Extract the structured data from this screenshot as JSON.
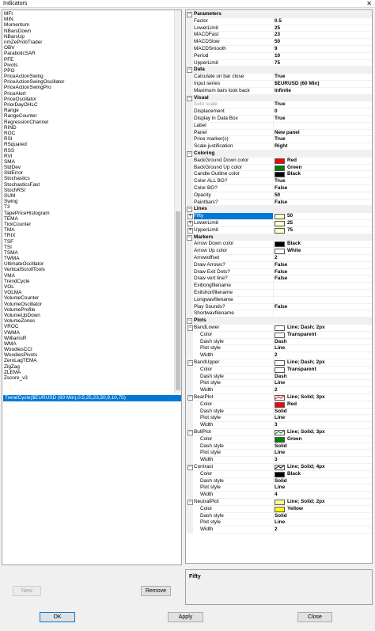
{
  "window": {
    "title": "Indicators",
    "close_glyph": "✕"
  },
  "indicator_list": {
    "items": [
      "MFI",
      "MIN",
      "Momentum",
      "NBarsDown",
      "NBarsUp",
      "nmZeProbTrader",
      "OBV",
      "ParabolicSAR",
      "PFE",
      "Pivots",
      "PPO",
      "PriceActionSwing",
      "PriceActionSwingOscillator",
      "PriceActionSwingPro",
      "PriceAlert",
      "PriceOscillator",
      "PriorDayOHLC",
      "Range",
      "RangeCounter",
      "RegressionChannel",
      "RIND",
      "ROC",
      "RSI",
      "RSquared",
      "RSS",
      "RVI",
      "SMA",
      "StdDev",
      "StdError",
      "Stochastics",
      "StochasticsFast",
      "StochRSI",
      "SUM",
      "Swing",
      "T3",
      "TapePriceHistogram",
      "TEMA",
      "TickCounter",
      "TMA",
      "TRIX",
      "TSF",
      "TSI",
      "TSMA",
      "TWMA",
      "UltimateOscillator",
      "VerticalScrollTools",
      "VMA",
      "TrendCycle",
      "VOL",
      "VOLMA",
      "VolumeCounter",
      "VolumeOscillator",
      "VolumeProfile",
      "VolumeUpDown",
      "VolumeZones",
      "VROC",
      "VWMA",
      "WilliamsR",
      "WMA",
      "WoodiesCCI",
      "WoodiesPivots",
      "ZeroLagTEMA",
      "ZigZag",
      "ZLEMA",
      "Zscore_v3"
    ],
    "selected": "TrendCycle($EURUSD (60 Min),0.5,25,23,50,9,10,75)"
  },
  "buttons": {
    "new": "New",
    "remove": "Remove",
    "ok": "OK",
    "apply": "Apply",
    "close": "Close"
  },
  "description": "Fifty",
  "properties": [
    {
      "type": "section",
      "label": "Parameters"
    },
    {
      "label": "Factor",
      "value": "0.5"
    },
    {
      "label": "LowerLimit",
      "value": "25"
    },
    {
      "label": "MACDFast",
      "value": "23"
    },
    {
      "label": "MACDSlow",
      "value": "50"
    },
    {
      "label": "MACDSmooth",
      "value": "9"
    },
    {
      "label": "Period",
      "value": "10"
    },
    {
      "label": "UpperLimit",
      "value": "75"
    },
    {
      "type": "section",
      "label": "Data"
    },
    {
      "label": "Calculate on bar close",
      "value": "True"
    },
    {
      "label": "Input series",
      "value": "$EURUSD (60 Min)"
    },
    {
      "label": "Maximum bars look back",
      "value": "Infinite"
    },
    {
      "type": "section",
      "label": "Visual"
    },
    {
      "label": "Auto scale",
      "value": "True",
      "dim": true
    },
    {
      "label": "Displacement",
      "value": "0"
    },
    {
      "label": "Display in Data Box",
      "value": "True"
    },
    {
      "label": "Label",
      "value": ""
    },
    {
      "label": "Panel",
      "value": "New panel"
    },
    {
      "label": "Price marker(s)",
      "value": "True"
    },
    {
      "label": "Scale justification",
      "value": "Right"
    },
    {
      "type": "section",
      "label": "Coloring"
    },
    {
      "label": "BackGround Down color",
      "value": "Red",
      "color": "#ff0000"
    },
    {
      "label": "BackGround Up color",
      "value": "Green",
      "color": "#008000"
    },
    {
      "label": "Candle Outline color",
      "value": "Black",
      "color": "#000000"
    },
    {
      "label": "Color ALL BG?",
      "value": "True"
    },
    {
      "label": "Color BG?",
      "value": "False"
    },
    {
      "label": "Opacity",
      "value": "50"
    },
    {
      "label": "Paintbars?",
      "value": "False"
    },
    {
      "type": "section",
      "label": "Lines"
    },
    {
      "label": "Fifty",
      "value": "50",
      "color": "#ffffc8",
      "toggle": "+",
      "selected": true
    },
    {
      "label": "LowerLimit",
      "value": "25",
      "color": "#ffffc8",
      "toggle": "+"
    },
    {
      "label": "UpperLimit",
      "value": "75",
      "color": "#ffffc8",
      "toggle": "+"
    },
    {
      "type": "section",
      "label": "Markers"
    },
    {
      "label": "Arrow Down color",
      "value": "Black",
      "color": "#000000"
    },
    {
      "label": "Arrow Up color",
      "value": "White",
      "color": "#ffffff"
    },
    {
      "label": "Arrowoffset",
      "value": "2"
    },
    {
      "label": "Draw Arrows?",
      "value": "False"
    },
    {
      "label": "Draw Exit Dots?",
      "value": "False"
    },
    {
      "label": "Draw vert line?",
      "value": "False"
    },
    {
      "label": "Exitlongfilename",
      "value": ""
    },
    {
      "label": "Exitshortfilename",
      "value": ""
    },
    {
      "label": "Longwavfilename",
      "value": ""
    },
    {
      "label": "Play Sounds?",
      "value": "False"
    },
    {
      "label": "Shortwavfilename",
      "value": ""
    },
    {
      "type": "section",
      "label": "Plots"
    },
    {
      "label": "BandLower",
      "value": "Line; Dash; 2px",
      "color": "#ffffff",
      "toggle": "−"
    },
    {
      "label": "Color",
      "value": "Transparent",
      "color": "#ffffff",
      "indent": true
    },
    {
      "label": "Dash style",
      "value": "Dash",
      "indent": true
    },
    {
      "label": "Plot style",
      "value": "Line",
      "indent": true
    },
    {
      "label": "Width",
      "value": "2",
      "indent": true
    },
    {
      "label": "BandUpper",
      "value": "Line; Dash; 2px",
      "color": "#ffffff",
      "toggle": "−"
    },
    {
      "label": "Color",
      "value": "Transparent",
      "color": "#ffffff",
      "indent": true
    },
    {
      "label": "Dash style",
      "value": "Dash",
      "indent": true
    },
    {
      "label": "Plot style",
      "value": "Line",
      "indent": true
    },
    {
      "label": "Width",
      "value": "2",
      "indent": true
    },
    {
      "label": "BearPlot",
      "value": "Line; Solid; 3px",
      "color": "#ffffff",
      "toggle": "−",
      "linecolor": "#ff0000"
    },
    {
      "label": "Color",
      "value": "Red",
      "color": "#ff0000",
      "indent": true
    },
    {
      "label": "Dash style",
      "value": "Solid",
      "indent": true
    },
    {
      "label": "Plot style",
      "value": "Line",
      "indent": true
    },
    {
      "label": "Width",
      "value": "3",
      "indent": true
    },
    {
      "label": "BullPlot",
      "value": "Line; Solid; 3px",
      "color": "#ffffff",
      "toggle": "−",
      "linecolor": "#008000"
    },
    {
      "label": "Color",
      "value": "Green",
      "color": "#008000",
      "indent": true
    },
    {
      "label": "Dash style",
      "value": "Solid",
      "indent": true
    },
    {
      "label": "Plot style",
      "value": "Line",
      "indent": true
    },
    {
      "label": "Width",
      "value": "3",
      "indent": true
    },
    {
      "label": "Contrast",
      "value": "Line; Solid; 4px",
      "color": "#ffffff",
      "toggle": "−",
      "linecolor": "#000000"
    },
    {
      "label": "Color",
      "value": "Black",
      "color": "#000000",
      "indent": true
    },
    {
      "label": "Dash style",
      "value": "Solid",
      "indent": true
    },
    {
      "label": "Plot style",
      "value": "Line",
      "indent": true
    },
    {
      "label": "Width",
      "value": "4",
      "indent": true
    },
    {
      "label": "NeutralPlot",
      "value": "Line; Solid; 2px",
      "color": "#ffff99",
      "toggle": "−"
    },
    {
      "label": "Color",
      "value": "Yellow",
      "color": "#ffff00",
      "indent": true
    },
    {
      "label": "Dash style",
      "value": "Solid",
      "indent": true
    },
    {
      "label": "Plot style",
      "value": "Line",
      "indent": true
    },
    {
      "label": "Width",
      "value": "2",
      "indent": true
    }
  ]
}
